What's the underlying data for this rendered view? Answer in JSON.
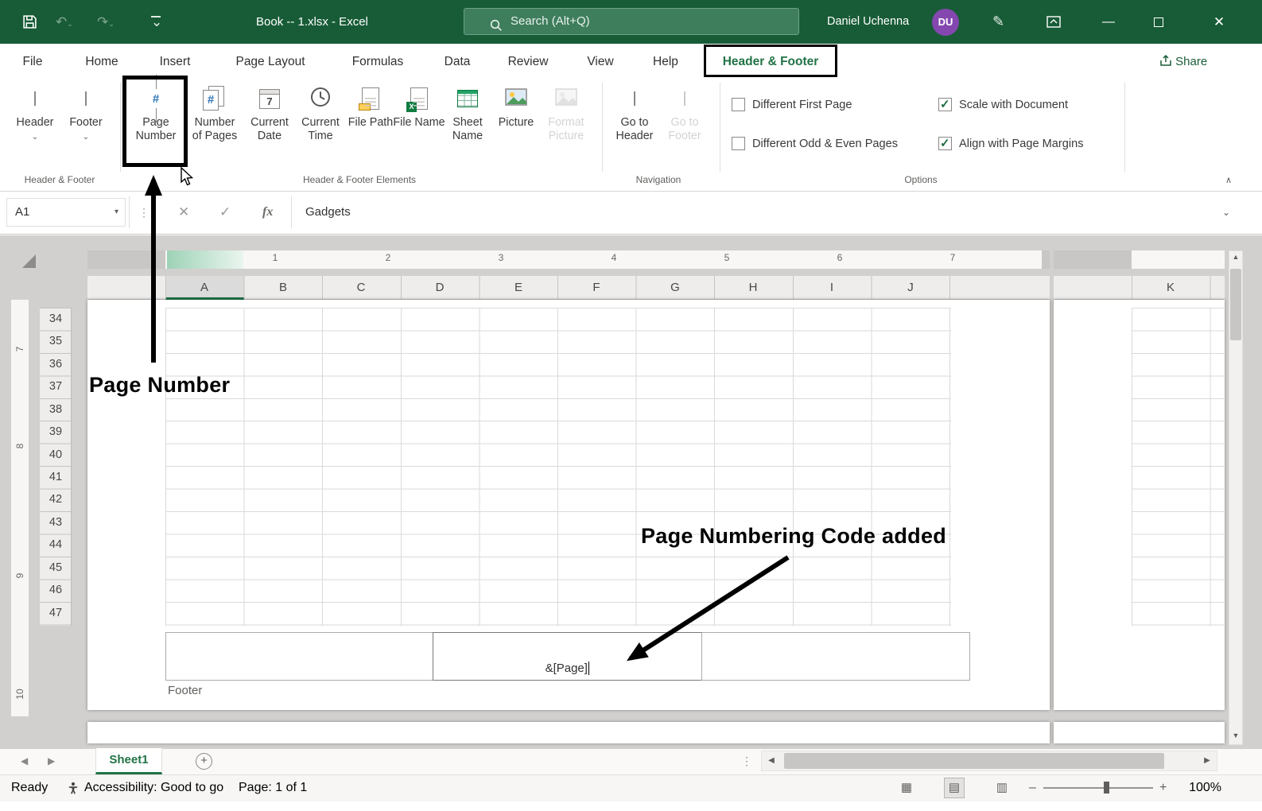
{
  "titlebar": {
    "title": "Book -- 1.xlsx  -  Excel",
    "search_placeholder": "Search (Alt+Q)",
    "user_name": "Daniel Uchenna",
    "user_initials": "DU"
  },
  "menu": {
    "tabs": [
      "File",
      "Home",
      "Insert",
      "Page Layout",
      "Formulas",
      "Data",
      "Review",
      "View",
      "Help"
    ],
    "active_tab": "Header & Footer",
    "share": "Share"
  },
  "ribbon": {
    "group_labels": [
      "Header & Footer",
      "Header & Footer Elements",
      "Navigation",
      "Options"
    ],
    "buttons": {
      "header": "Header",
      "footer": "Footer",
      "page_number": "Page Number",
      "number_of_pages": "Number of Pages",
      "current_date": "Current Date",
      "current_time": "Current Time",
      "file_path": "File Path",
      "file_name": "File Name",
      "sheet_name": "Sheet Name",
      "picture": "Picture",
      "format_picture": "Format Picture",
      "go_to_header": "Go to Header",
      "go_to_footer": "Go to Footer"
    },
    "options": [
      {
        "label": "Different First Page",
        "checked": false
      },
      {
        "label": "Different Odd & Even Pages",
        "checked": false
      },
      {
        "label": "Scale with Document",
        "checked": true
      },
      {
        "label": "Align with Page Margins",
        "checked": true
      }
    ]
  },
  "formula_bar": {
    "name_box": "A1",
    "fx": "fx",
    "value": "Gadgets"
  },
  "sheet": {
    "columns": [
      "A",
      "B",
      "C",
      "D",
      "E",
      "F",
      "G",
      "H",
      "I",
      "J"
    ],
    "far_column": "K",
    "rows": [
      "34",
      "35",
      "36",
      "37",
      "38",
      "39",
      "40",
      "41",
      "42",
      "43",
      "44",
      "45",
      "46",
      "47"
    ],
    "h_ruler": [
      "1",
      "2",
      "3",
      "4",
      "5",
      "6",
      "7"
    ],
    "v_ruler": [
      "7",
      "8",
      "9",
      "10"
    ],
    "footer_code": "&[Page]",
    "footer_label": "Footer"
  },
  "annotations": {
    "page_number": "Page Number",
    "code_added": "Page Numbering Code added"
  },
  "sheet_tabs": {
    "active": "Sheet1"
  },
  "status_bar": {
    "ready": "Ready",
    "accessibility": "Accessibility: Good to go",
    "page": "Page: 1 of 1",
    "zoom": "100%"
  },
  "colors": {
    "titlebar_green": "#185C37",
    "excel_green": "#217346",
    "avatar_purple": "#8447AF",
    "annotation_black": "#000000"
  }
}
